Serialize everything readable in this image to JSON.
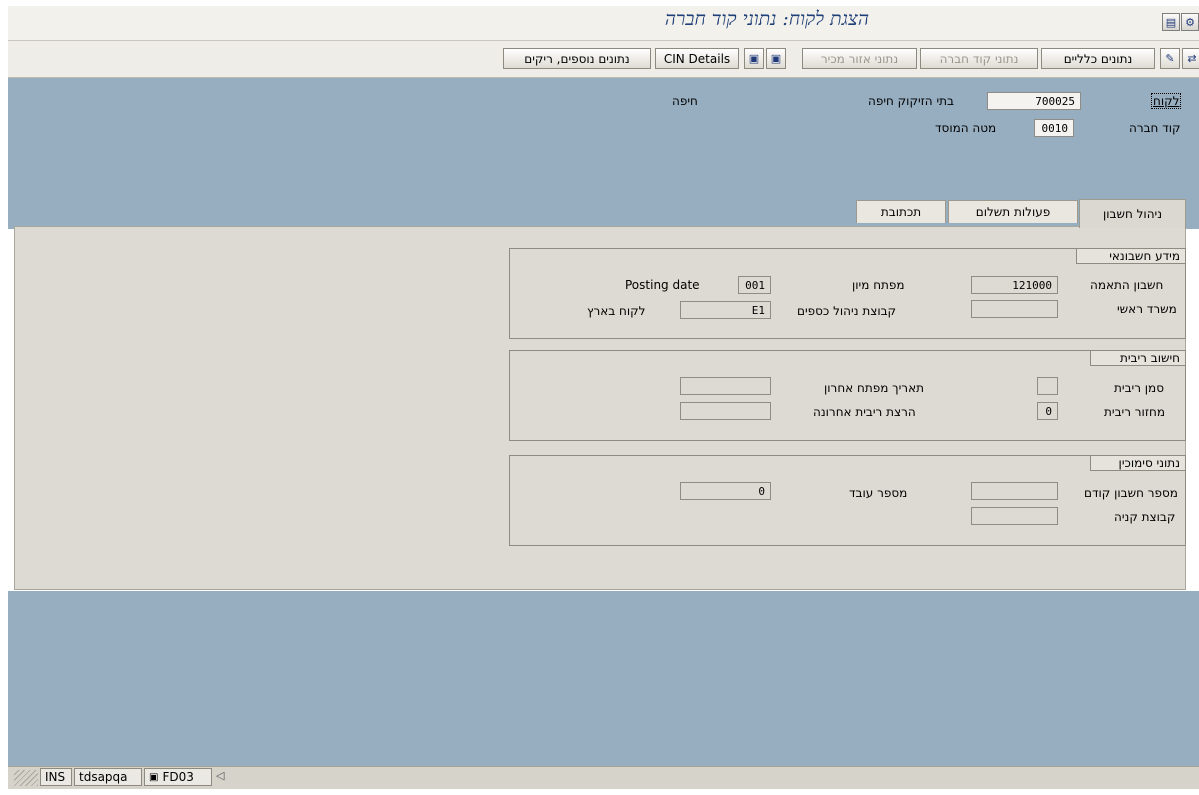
{
  "title": "הצגת לקוח: נתוני קוד חברה",
  "toolbar": {
    "general_data": "נתונים כלליים",
    "company_code_data": "נתוני קוד חברה",
    "sales_area_data": "נתוני אזור מכיר",
    "cin_details": "CIN Details",
    "additional_data": "נתונים נוספים, ריקים"
  },
  "header": {
    "customer_label": "לקוח",
    "customer_value": "700025",
    "customer_name": "בתי הזיקוק חיפה",
    "customer_city": "חיפה",
    "company_code_label": "קוד חברה",
    "company_code_value": "0010",
    "company_name": "מטה המוסד"
  },
  "tabs": [
    {
      "label": "ניהול חשבון"
    },
    {
      "label": "פעולות תשלום"
    },
    {
      "label": "תכתובת"
    }
  ],
  "accounting": {
    "title": "מידע חשבונאי",
    "recon_label": "חשבון התאמה",
    "recon_value": "121000",
    "head_office_label": "משרד ראשי",
    "head_office_value": "",
    "sort_key_label": "מפתח מיון",
    "sort_key_value": "001",
    "sort_key_text": "Posting date",
    "cash_group_label": "קבוצת ניהול כספים",
    "cash_group_value": "E1",
    "cash_group_text": "לקוח בארץ"
  },
  "interest": {
    "title": "חישוב ריבית",
    "indicator_label": "סמן ריבית",
    "indicator_value": "",
    "cycle_label": "מחזור ריבית",
    "cycle_value": "0",
    "last_key_date_label": "תאריך מפתח אחרון",
    "last_key_date_value": "",
    "last_run_label": "הרצת ריבית אחרונה",
    "last_run_value": ""
  },
  "reference": {
    "title": "נתוני סימוכין",
    "prev_account_label": "מספר חשבון קודם",
    "prev_account_value": "",
    "employee_label": "מספר עובד",
    "employee_value": "0",
    "buying_group_label": "קבוצת קניה",
    "buying_group_value": ""
  },
  "status": {
    "mode": "INS",
    "server": "tdsapqa",
    "transaction": "FD03"
  }
}
